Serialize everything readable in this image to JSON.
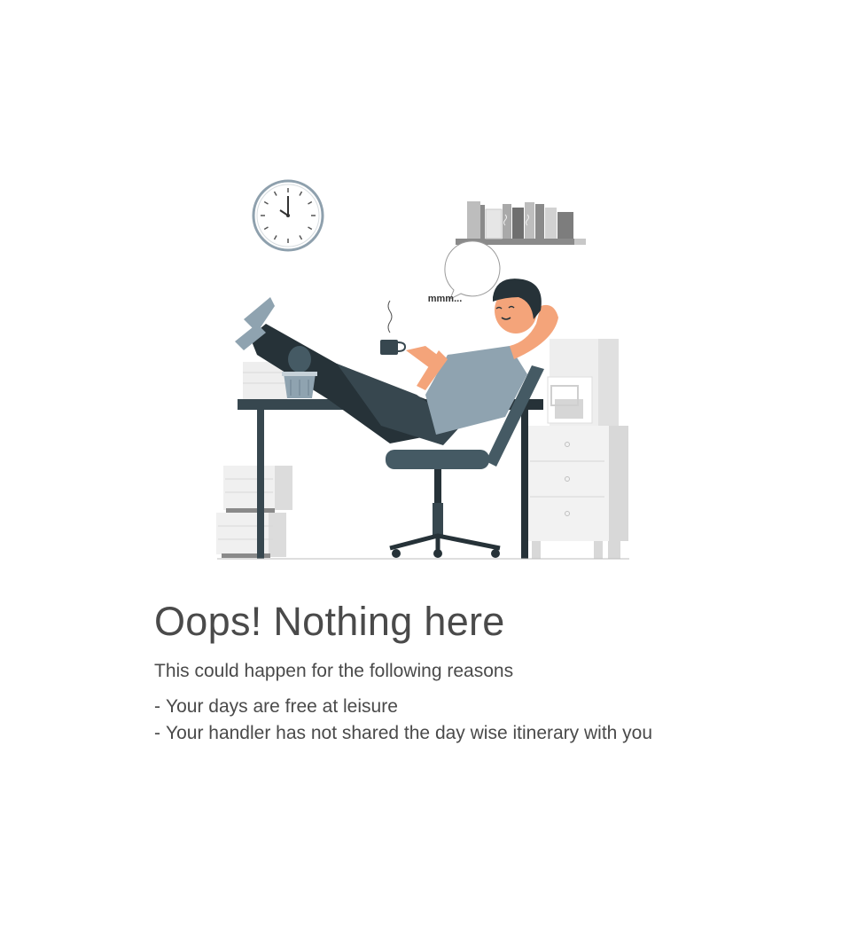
{
  "empty_state": {
    "title": "Oops! Nothing here",
    "subtitle": "This could happen for the following reasons",
    "reasons": [
      "Your days are free at leisure",
      "Your handler has not shared the day wise itinerary with you"
    ],
    "illustration": {
      "speech_bubble_text": "mmm...",
      "icons": [
        "wall-clock-icon",
        "bookshelf-icon",
        "coffee-cup-icon",
        "cactus-icon",
        "office-chair-icon",
        "coffee-machine-icon"
      ]
    }
  },
  "colors": {
    "text": "#4a4a4a",
    "shirt": "#8fa3b0",
    "dark": "#263238",
    "skin": "#f4a47a",
    "light_gray": "#e0e0e0"
  }
}
